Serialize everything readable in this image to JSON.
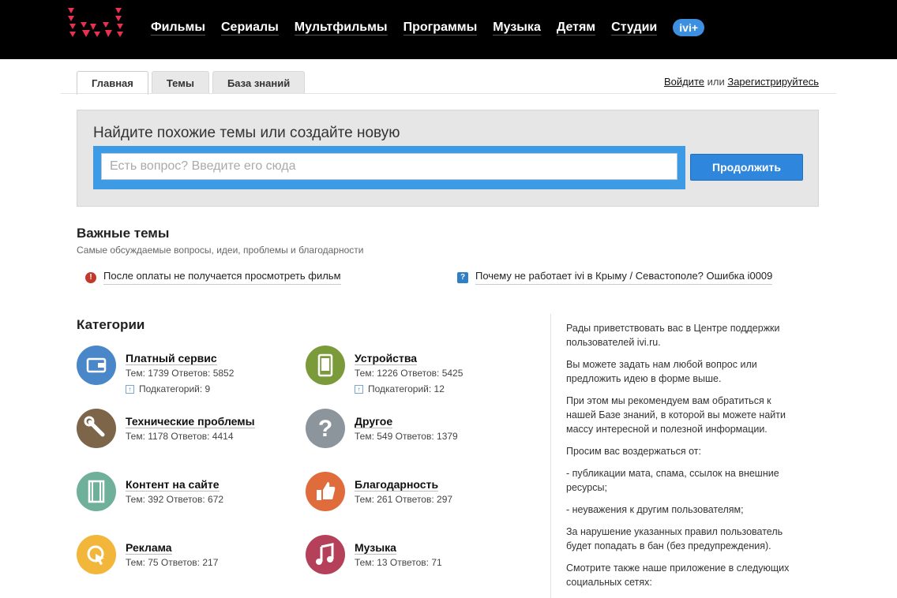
{
  "header": {
    "nav": [
      "Фильмы",
      "Сериалы",
      "Мультфильмы",
      "Программы",
      "Музыка",
      "Детям",
      "Студии"
    ],
    "ivi_plus": "ivi+"
  },
  "tabs": [
    {
      "label": "Главная",
      "active": true
    },
    {
      "label": "Темы",
      "active": false
    },
    {
      "label": "База знаний",
      "active": false
    }
  ],
  "auth": {
    "login": "Войдите",
    "or": " или ",
    "register": "Зарегистрируйтесь"
  },
  "search": {
    "title": "Найдите похожие темы или создайте новую",
    "placeholder": "Есть вопрос? Введите его сюда",
    "button": "Продолжить"
  },
  "important": {
    "title": "Важные темы",
    "subtitle": "Самые обсуждаемые вопросы, идеи, проблемы и благодарности",
    "items": [
      {
        "icon": "alert-icon",
        "label": "После оплаты не получается просмотреть фильм"
      },
      {
        "icon": "question-icon",
        "label": "Почему не работает ivi в Крыму / Севастополе? Ошибка i0009"
      }
    ]
  },
  "categories": {
    "title": "Категории",
    "items": [
      {
        "name": "Платный сервис",
        "stats": "Тем: 1739 Ответов: 5852",
        "sub": "Подкатегорий: 9",
        "color": "#4a87c9",
        "icon": "wallet-icon"
      },
      {
        "name": "Устройства",
        "stats": "Тем: 1226 Ответов: 5425",
        "sub": "Подкатегорий: 12",
        "color": "#7b9b3a",
        "icon": "phone-icon"
      },
      {
        "name": "Технические проблемы",
        "stats": "Тем: 1178 Ответов: 4414",
        "sub": "",
        "color": "#7d6549",
        "icon": "wrench-icon"
      },
      {
        "name": "Другое",
        "stats": "Тем: 549 Ответов: 1379",
        "sub": "",
        "color": "#8d959c",
        "icon": "question-mark-icon"
      },
      {
        "name": "Контент на сайте",
        "stats": "Тем: 392 Ответов: 672",
        "sub": "",
        "color": "#6fb09a",
        "icon": "film-icon"
      },
      {
        "name": "Благодарность",
        "stats": "Тем: 261 Ответов: 297",
        "sub": "",
        "color": "#e06c3c",
        "icon": "thumbs-up-icon"
      },
      {
        "name": "Реклама",
        "stats": "Тем: 75 Ответов: 217",
        "sub": "",
        "color": "#f2b63a",
        "icon": "cursor-icon"
      },
      {
        "name": "Музыка",
        "stats": "Тем: 13 Ответов: 71",
        "sub": "",
        "color": "#b5405a",
        "icon": "music-note-icon"
      }
    ]
  },
  "sidebar": {
    "paragraphs": [
      "Рады приветствовать вас в Центре поддержки пользователей ivi.ru.",
      "Вы можете задать нам любой вопрос или предложить идею в форме выше.",
      "При этом мы рекомендуем вам обратиться к нашей Базе знаний, в которой вы можете найти массу интересной и полезной информации.",
      "Просим вас воздержаться от:",
      "- публикации мата, спама, ссылок на внешние ресурсы;",
      "- неуважения к другим пользователям;",
      "За нарушение указанных правил пользователь будет попадать в бан (без предупреждения).",
      "Смотрите также наше приложение в следующих социальных сетях:"
    ]
  }
}
